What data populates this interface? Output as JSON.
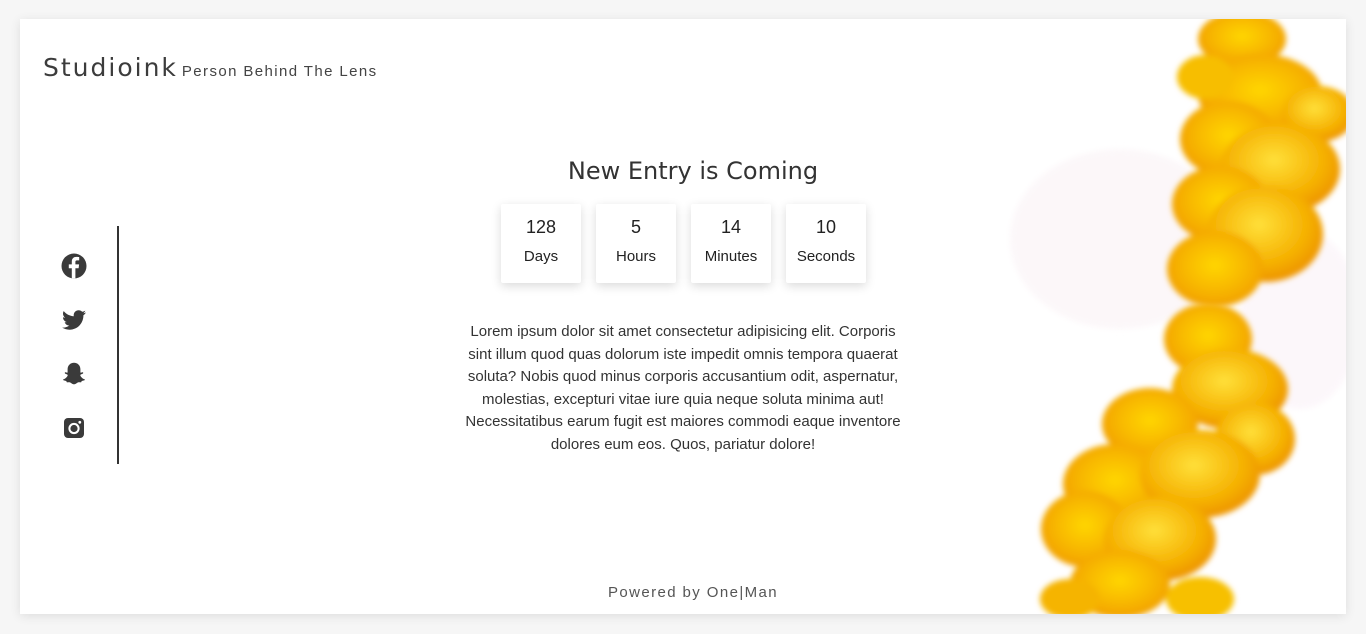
{
  "brand": {
    "name": "Studioink",
    "tagline": "Person Behind The Lens"
  },
  "social": [
    {
      "name": "facebook-icon"
    },
    {
      "name": "twitter-icon"
    },
    {
      "name": "snapchat-icon"
    },
    {
      "name": "instagram-icon"
    }
  ],
  "headline": "New Entry is Coming",
  "countdown": {
    "days": {
      "value": "128",
      "label": "Days"
    },
    "hours": {
      "value": "5",
      "label": "Hours"
    },
    "minutes": {
      "value": "14",
      "label": "Minutes"
    },
    "seconds": {
      "value": "10",
      "label": "Seconds"
    }
  },
  "description": "Lorem ipsum dolor sit amet consectetur adipisicing elit. Corporis sint illum quod quas dolorum iste impedit omnis tempora quaerat soluta? Nobis quod minus corporis accusantium odit, aspernatur, molestias, excepturi vitae iure quia neque soluta minima aut! Necessitatibus earum fugit est maiores commodi eaque inventore dolores eum eos. Quos, pariatur dolore!",
  "footer": "Powered by One|Man",
  "colors": {
    "ink_primary": "#f7b400",
    "ink_secondary": "#ffd200",
    "ink_accent": "#f08c00",
    "text": "#333333",
    "background": "#ffffff"
  }
}
